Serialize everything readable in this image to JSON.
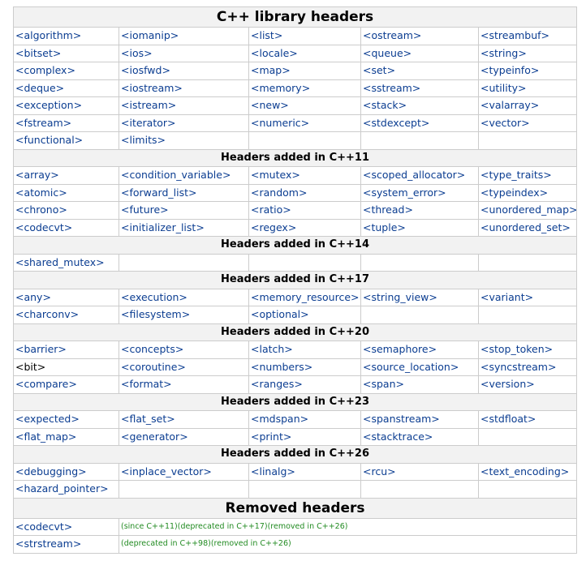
{
  "title": "C++ library headers",
  "sections": [
    {
      "heading": "",
      "rows": [
        [
          {
            "t": "<algorithm>"
          },
          {
            "t": "<iomanip>"
          },
          {
            "t": "<list>"
          },
          {
            "t": "<ostream>"
          },
          {
            "t": "<streambuf>"
          }
        ],
        [
          {
            "t": "<bitset>"
          },
          {
            "t": "<ios>"
          },
          {
            "t": "<locale>"
          },
          {
            "t": "<queue>"
          },
          {
            "t": "<string>"
          }
        ],
        [
          {
            "t": "<complex>"
          },
          {
            "t": "<iosfwd>"
          },
          {
            "t": "<map>"
          },
          {
            "t": "<set>"
          },
          {
            "t": "<typeinfo>"
          }
        ],
        [
          {
            "t": "<deque>"
          },
          {
            "t": "<iostream>"
          },
          {
            "t": "<memory>"
          },
          {
            "t": "<sstream>"
          },
          {
            "t": "<utility>"
          }
        ],
        [
          {
            "t": "<exception>"
          },
          {
            "t": "<istream>"
          },
          {
            "t": "<new>"
          },
          {
            "t": "<stack>"
          },
          {
            "t": "<valarray>"
          }
        ],
        [
          {
            "t": "<fstream>"
          },
          {
            "t": "<iterator>"
          },
          {
            "t": "<numeric>"
          },
          {
            "t": "<stdexcept>"
          },
          {
            "t": "<vector>"
          }
        ],
        [
          {
            "t": "<functional>"
          },
          {
            "t": "<limits>"
          },
          {
            "t": ""
          },
          {
            "t": ""
          },
          {
            "t": ""
          }
        ]
      ]
    },
    {
      "heading": "Headers added in C++11",
      "rows": [
        [
          {
            "t": "<array>"
          },
          {
            "t": "<condition_variable>"
          },
          {
            "t": "<mutex>"
          },
          {
            "t": "<scoped_allocator>"
          },
          {
            "t": "<type_traits>"
          }
        ],
        [
          {
            "t": "<atomic>"
          },
          {
            "t": "<forward_list>"
          },
          {
            "t": "<random>"
          },
          {
            "t": "<system_error>"
          },
          {
            "t": "<typeindex>"
          }
        ],
        [
          {
            "t": "<chrono>"
          },
          {
            "t": "<future>"
          },
          {
            "t": "<ratio>"
          },
          {
            "t": "<thread>"
          },
          {
            "t": "<unordered_map>"
          }
        ],
        [
          {
            "t": "<codecvt>"
          },
          {
            "t": "<initializer_list>"
          },
          {
            "t": "<regex>"
          },
          {
            "t": "<tuple>"
          },
          {
            "t": "<unordered_set>"
          }
        ]
      ]
    },
    {
      "heading": "Headers added in C++14",
      "rows": [
        [
          {
            "t": "<shared_mutex>"
          },
          {
            "t": ""
          },
          {
            "t": ""
          },
          {
            "t": ""
          },
          {
            "t": ""
          }
        ]
      ]
    },
    {
      "heading": "Headers added in C++17",
      "rows": [
        [
          {
            "t": "<any>"
          },
          {
            "t": "<execution>"
          },
          {
            "t": "<memory_resource>"
          },
          {
            "t": "<string_view>"
          },
          {
            "t": "<variant>"
          }
        ],
        [
          {
            "t": "<charconv>"
          },
          {
            "t": "<filesystem>"
          },
          {
            "t": "<optional>"
          },
          {
            "t": ""
          },
          {
            "t": ""
          }
        ]
      ]
    },
    {
      "heading": "Headers added in C++20",
      "rows": [
        [
          {
            "t": "<barrier>"
          },
          {
            "t": "<concepts>"
          },
          {
            "t": "<latch>"
          },
          {
            "t": "<semaphore>"
          },
          {
            "t": "<stop_token>"
          }
        ],
        [
          {
            "t": "<bit>",
            "plain": true
          },
          {
            "t": "<coroutine>"
          },
          {
            "t": "<numbers>"
          },
          {
            "t": "<source_location>"
          },
          {
            "t": "<syncstream>"
          }
        ],
        [
          {
            "t": "<compare>"
          },
          {
            "t": "<format>"
          },
          {
            "t": "<ranges>"
          },
          {
            "t": "<span>"
          },
          {
            "t": "<version>"
          }
        ]
      ]
    },
    {
      "heading": "Headers added in C++23",
      "rows": [
        [
          {
            "t": "<expected>"
          },
          {
            "t": "<flat_set>"
          },
          {
            "t": "<mdspan>"
          },
          {
            "t": "<spanstream>"
          },
          {
            "t": "<stdfloat>"
          }
        ],
        [
          {
            "t": "<flat_map>"
          },
          {
            "t": "<generator>"
          },
          {
            "t": "<print>"
          },
          {
            "t": "<stacktrace>"
          },
          {
            "t": ""
          }
        ]
      ]
    },
    {
      "heading": "Headers added in C++26",
      "rows": [
        [
          {
            "t": "<debugging>"
          },
          {
            "t": "<inplace_vector>"
          },
          {
            "t": "<linalg>"
          },
          {
            "t": "<rcu>"
          },
          {
            "t": "<text_encoding>"
          }
        ],
        [
          {
            "t": "<hazard_pointer>"
          },
          {
            "t": ""
          },
          {
            "t": ""
          },
          {
            "t": ""
          },
          {
            "t": ""
          }
        ]
      ]
    }
  ],
  "removed": {
    "heading": "Removed headers",
    "rows": [
      {
        "name": "<codecvt>",
        "note": "(since C++11)(deprecated in C++17)(removed in C++26)"
      },
      {
        "name": "<strstream>",
        "note": "(deprecated in C++98)(removed in C++26)"
      }
    ]
  },
  "colors": {
    "link": "#0b3d91",
    "note": "#228b22",
    "header_bg": "#f2f2f2",
    "border": "#cccccc"
  }
}
